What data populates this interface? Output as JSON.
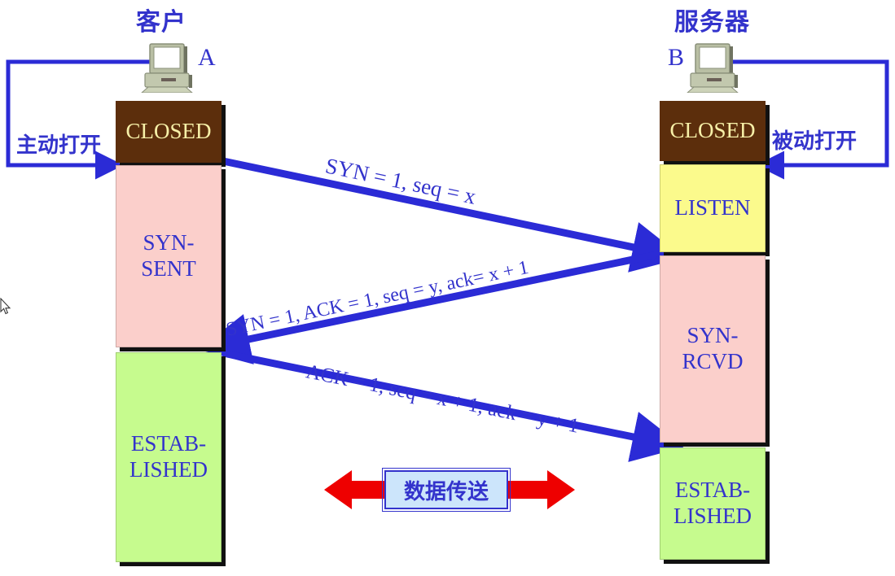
{
  "diagram": {
    "title_client": "客户",
    "title_server": "服务器",
    "host_a_letter": "A",
    "host_b_letter": "B",
    "client_open_label": "主动打开",
    "server_open_label": "被动打开",
    "data_transfer_label": "数据传送"
  },
  "client_states": [
    {
      "name": "CLOSED",
      "line1": "CLOSED",
      "line2": "",
      "color": "#5c2e0c"
    },
    {
      "name": "SYN-SENT",
      "line1": "SYN-",
      "line2": "SENT",
      "color": "#fbcfcb"
    },
    {
      "name": "ESTABLISHED",
      "line1": "ESTAB-",
      "line2": "LISHED",
      "color": "#c6fb8e"
    }
  ],
  "server_states": [
    {
      "name": "CLOSED",
      "line1": "CLOSED",
      "line2": "",
      "color": "#5c2e0c"
    },
    {
      "name": "LISTEN",
      "line1": "LISTEN",
      "line2": "",
      "color": "#fbfa8c"
    },
    {
      "name": "SYN-RCVD",
      "line1": "SYN-",
      "line2": "RCVD",
      "color": "#fbcfcb"
    },
    {
      "name": "ESTABLISHED",
      "line1": "ESTAB-",
      "line2": "LISHED",
      "color": "#c6fb8e"
    }
  ],
  "messages": [
    {
      "id": "syn",
      "text": "SYN = 1, seq = x",
      "direction": "client-to-server"
    },
    {
      "id": "synack",
      "text": "SYN = 1, ACK = 1, seq = y, ack= x + 1",
      "direction": "server-to-client"
    },
    {
      "id": "ack",
      "text": "ACK = 1, seq = x + 1, ack = y + 1",
      "direction": "client-to-server"
    }
  ],
  "colors": {
    "accent_blue": "#3333cc",
    "arrow_blue": "#2b2bd6",
    "closed_brown": "#5c2e0c",
    "closed_text": "#f7f0a8",
    "pink": "#fbcfcb",
    "yellow": "#fbfa8c",
    "green": "#c6fb8e",
    "data_arrow_red": "#ee0000",
    "data_box_fill": "#cce5fb"
  }
}
